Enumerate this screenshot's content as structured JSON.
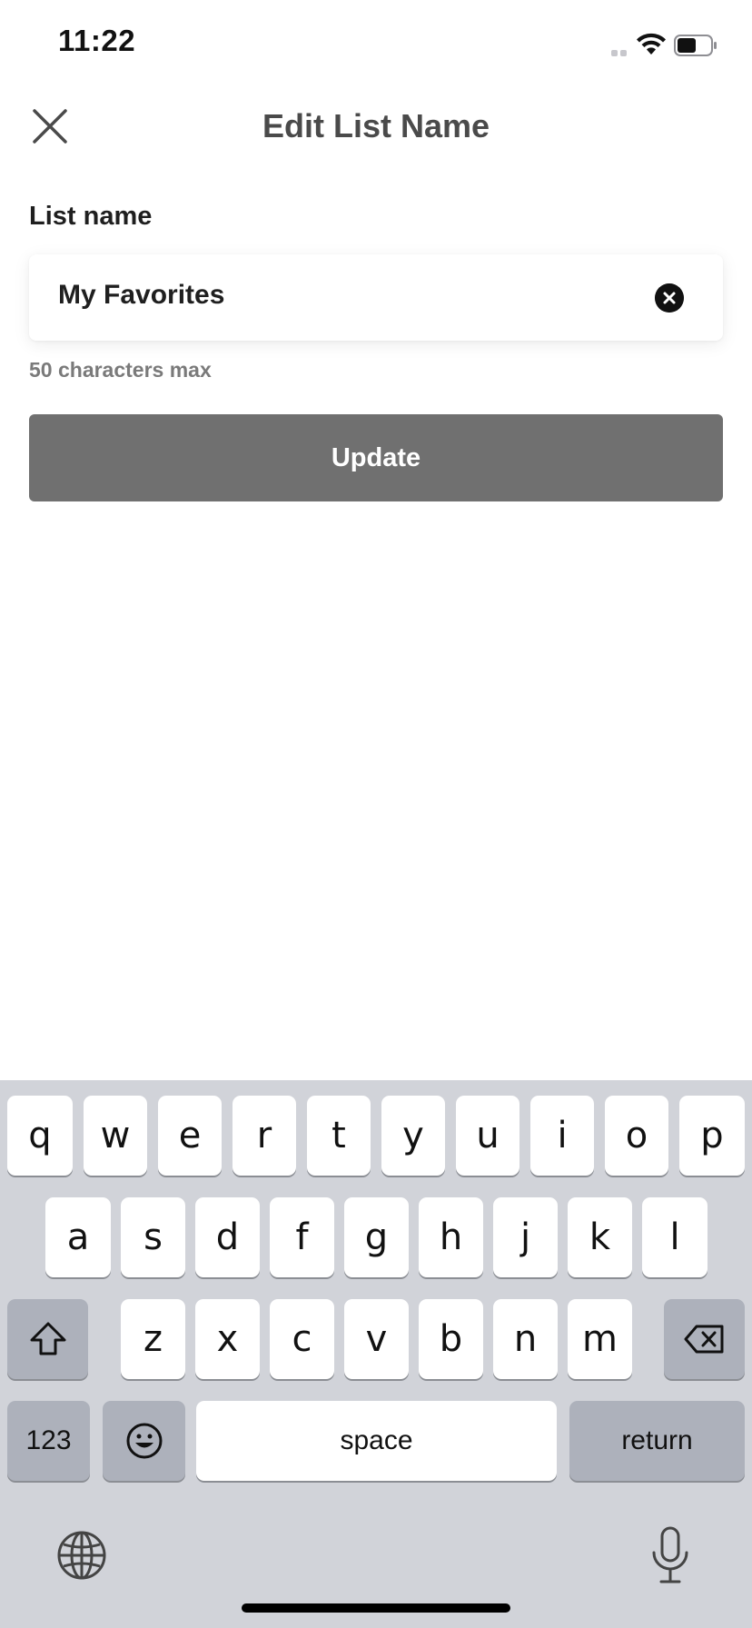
{
  "status_bar": {
    "time": "11:22"
  },
  "header": {
    "title": "Edit List Name"
  },
  "form": {
    "label": "List name",
    "value": "My Favorites",
    "helper": "50 characters max",
    "submit_label": "Update"
  },
  "keyboard": {
    "row1": [
      "q",
      "w",
      "e",
      "r",
      "t",
      "y",
      "u",
      "i",
      "o",
      "p"
    ],
    "row2": [
      "a",
      "s",
      "d",
      "f",
      "g",
      "h",
      "j",
      "k",
      "l"
    ],
    "row3": [
      "z",
      "x",
      "c",
      "v",
      "b",
      "n",
      "m"
    ],
    "numbers_label": "123",
    "space_label": "space",
    "return_label": "return"
  },
  "colors": {
    "accent_button": "#707070",
    "keyboard_bg": "#d1d3d9",
    "function_key": "#adb1bb"
  }
}
